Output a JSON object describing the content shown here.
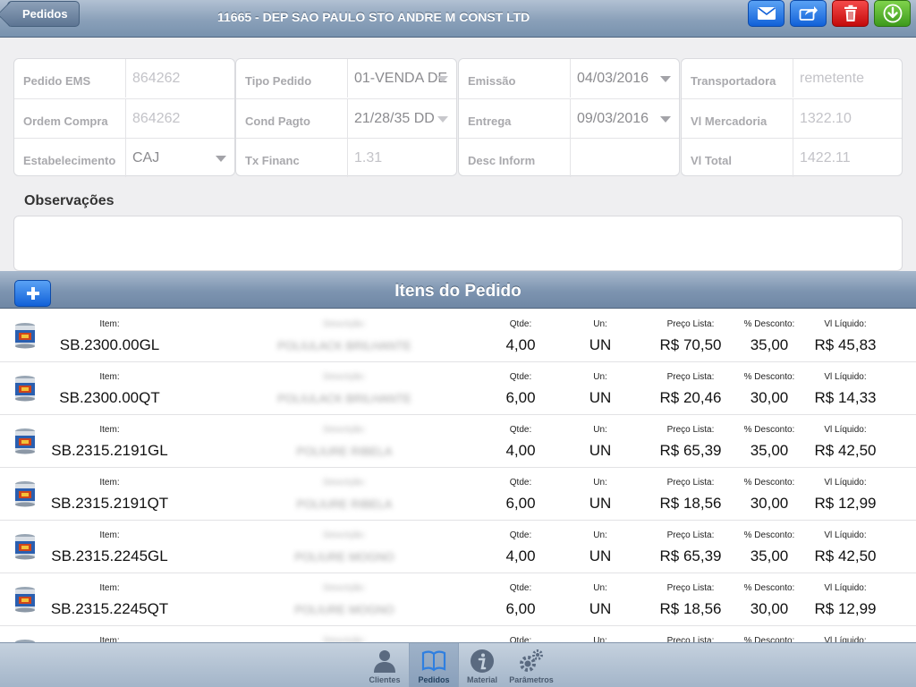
{
  "navbar": {
    "back_label": "Pedidos",
    "title": "11665 - DEP SAO PAULO STO ANDRE M CONST LTD",
    "actions": [
      "mail-icon",
      "share-icon",
      "trash-icon",
      "download-icon"
    ]
  },
  "form": {
    "col1": [
      {
        "label": "Pedido EMS",
        "value": "864262"
      },
      {
        "label": "Ordem Compra",
        "value": "864262"
      },
      {
        "label": "Estabelecimento",
        "value": "CAJ"
      }
    ],
    "col2": [
      {
        "label": "Tipo Pedido",
        "value": "01-VENDA DE"
      },
      {
        "label": "Cond Pagto",
        "value": "21/28/35 DD"
      },
      {
        "label": "Tx Financ",
        "value": "1.31"
      }
    ],
    "col3": [
      {
        "label": "Emissão",
        "value": "04/03/2016"
      },
      {
        "label": "Entrega",
        "value": "09/03/2016"
      },
      {
        "label": "Desc Inform",
        "value": ""
      }
    ],
    "col4": [
      {
        "label": "Transportadora",
        "value": "remetente"
      },
      {
        "label": "Vl Mercadoria",
        "value": "1322.10"
      },
      {
        "label": "Vl Total",
        "value": "1422.11"
      }
    ]
  },
  "observacoes": {
    "label": "Observações",
    "value": ""
  },
  "items_header": {
    "title": "Itens do Pedido"
  },
  "item_labels": {
    "item": "Item:",
    "descricao": "Descrição:",
    "qtde": "Qtde:",
    "un": "Un:",
    "preco": "Preço Lista:",
    "desconto": "% Desconto:",
    "vl": "Vl Líquido:"
  },
  "items": [
    {
      "item": "SB.2300.00GL",
      "descricao": "POLIULACK BRILHANTE",
      "qtde": "4,00",
      "un": "UN",
      "preco": "R$ 70,50",
      "desconto": "35,00",
      "vl": "R$ 45,83"
    },
    {
      "item": "SB.2300.00QT",
      "descricao": "POLIULACK BRILHANTE",
      "qtde": "6,00",
      "un": "UN",
      "preco": "R$ 20,46",
      "desconto": "30,00",
      "vl": "R$ 14,33"
    },
    {
      "item": "SB.2315.2191GL",
      "descricao": "POLIURE RIBELA",
      "qtde": "4,00",
      "un": "UN",
      "preco": "R$ 65,39",
      "desconto": "35,00",
      "vl": "R$ 42,50"
    },
    {
      "item": "SB.2315.2191QT",
      "descricao": "POLIURE RIBELA",
      "qtde": "6,00",
      "un": "UN",
      "preco": "R$ 18,56",
      "desconto": "30,00",
      "vl": "R$ 12,99"
    },
    {
      "item": "SB.2315.2245GL",
      "descricao": "POLIURE MOGNO",
      "qtde": "4,00",
      "un": "UN",
      "preco": "R$ 65,39",
      "desconto": "35,00",
      "vl": "R$ 42,50"
    },
    {
      "item": "SB.2315.2245QT",
      "descricao": "POLIURE MOGNO",
      "qtde": "6,00",
      "un": "UN",
      "preco": "R$ 18,56",
      "desconto": "30,00",
      "vl": "R$ 12,99"
    },
    {
      "item": "",
      "descricao": "",
      "qtde": "",
      "un": "",
      "preco": "",
      "desconto": "",
      "vl": ""
    }
  ],
  "tabs": [
    {
      "label": "Clientes",
      "icon": "person-icon"
    },
    {
      "label": "Pedidos",
      "icon": "book-icon",
      "active": true
    },
    {
      "label": "Material",
      "icon": "info-icon"
    },
    {
      "label": "Parâmetros",
      "icon": "gears-icon"
    }
  ],
  "colors": {
    "nav_blue": "#1161d8",
    "delete_red": "#c40b0b",
    "download_green": "#3d9a1c"
  }
}
